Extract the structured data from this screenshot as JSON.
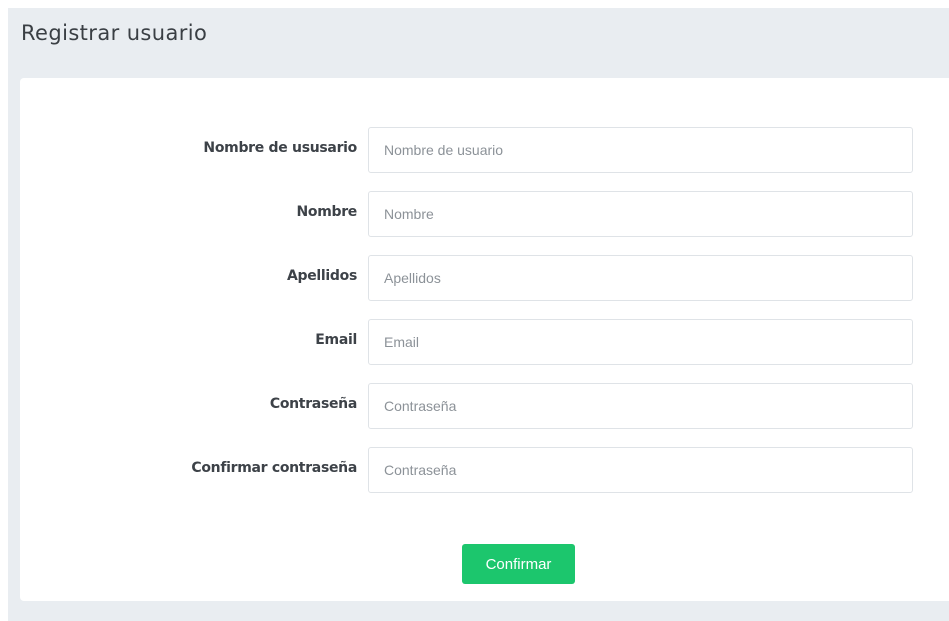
{
  "page": {
    "title": "Registrar usuario"
  },
  "form": {
    "fields": [
      {
        "label": "Nombre de ususario",
        "placeholder": "Nombre de usuario",
        "value": ""
      },
      {
        "label": "Nombre",
        "placeholder": "Nombre",
        "value": ""
      },
      {
        "label": "Apellidos",
        "placeholder": "Apellidos",
        "value": ""
      },
      {
        "label": "Email",
        "placeholder": "Email",
        "value": ""
      },
      {
        "label": "Contraseña",
        "placeholder": "Contraseña",
        "value": ""
      },
      {
        "label": "Confirmar contraseña",
        "placeholder": "Contraseña",
        "value": ""
      }
    ],
    "submit_label": "Confirmar"
  },
  "colors": {
    "page_background": "#e9edf1",
    "card_background": "#ffffff",
    "accent_button": "#1cc66d",
    "label_text": "#3d4248",
    "input_border": "#dfe3e7"
  }
}
